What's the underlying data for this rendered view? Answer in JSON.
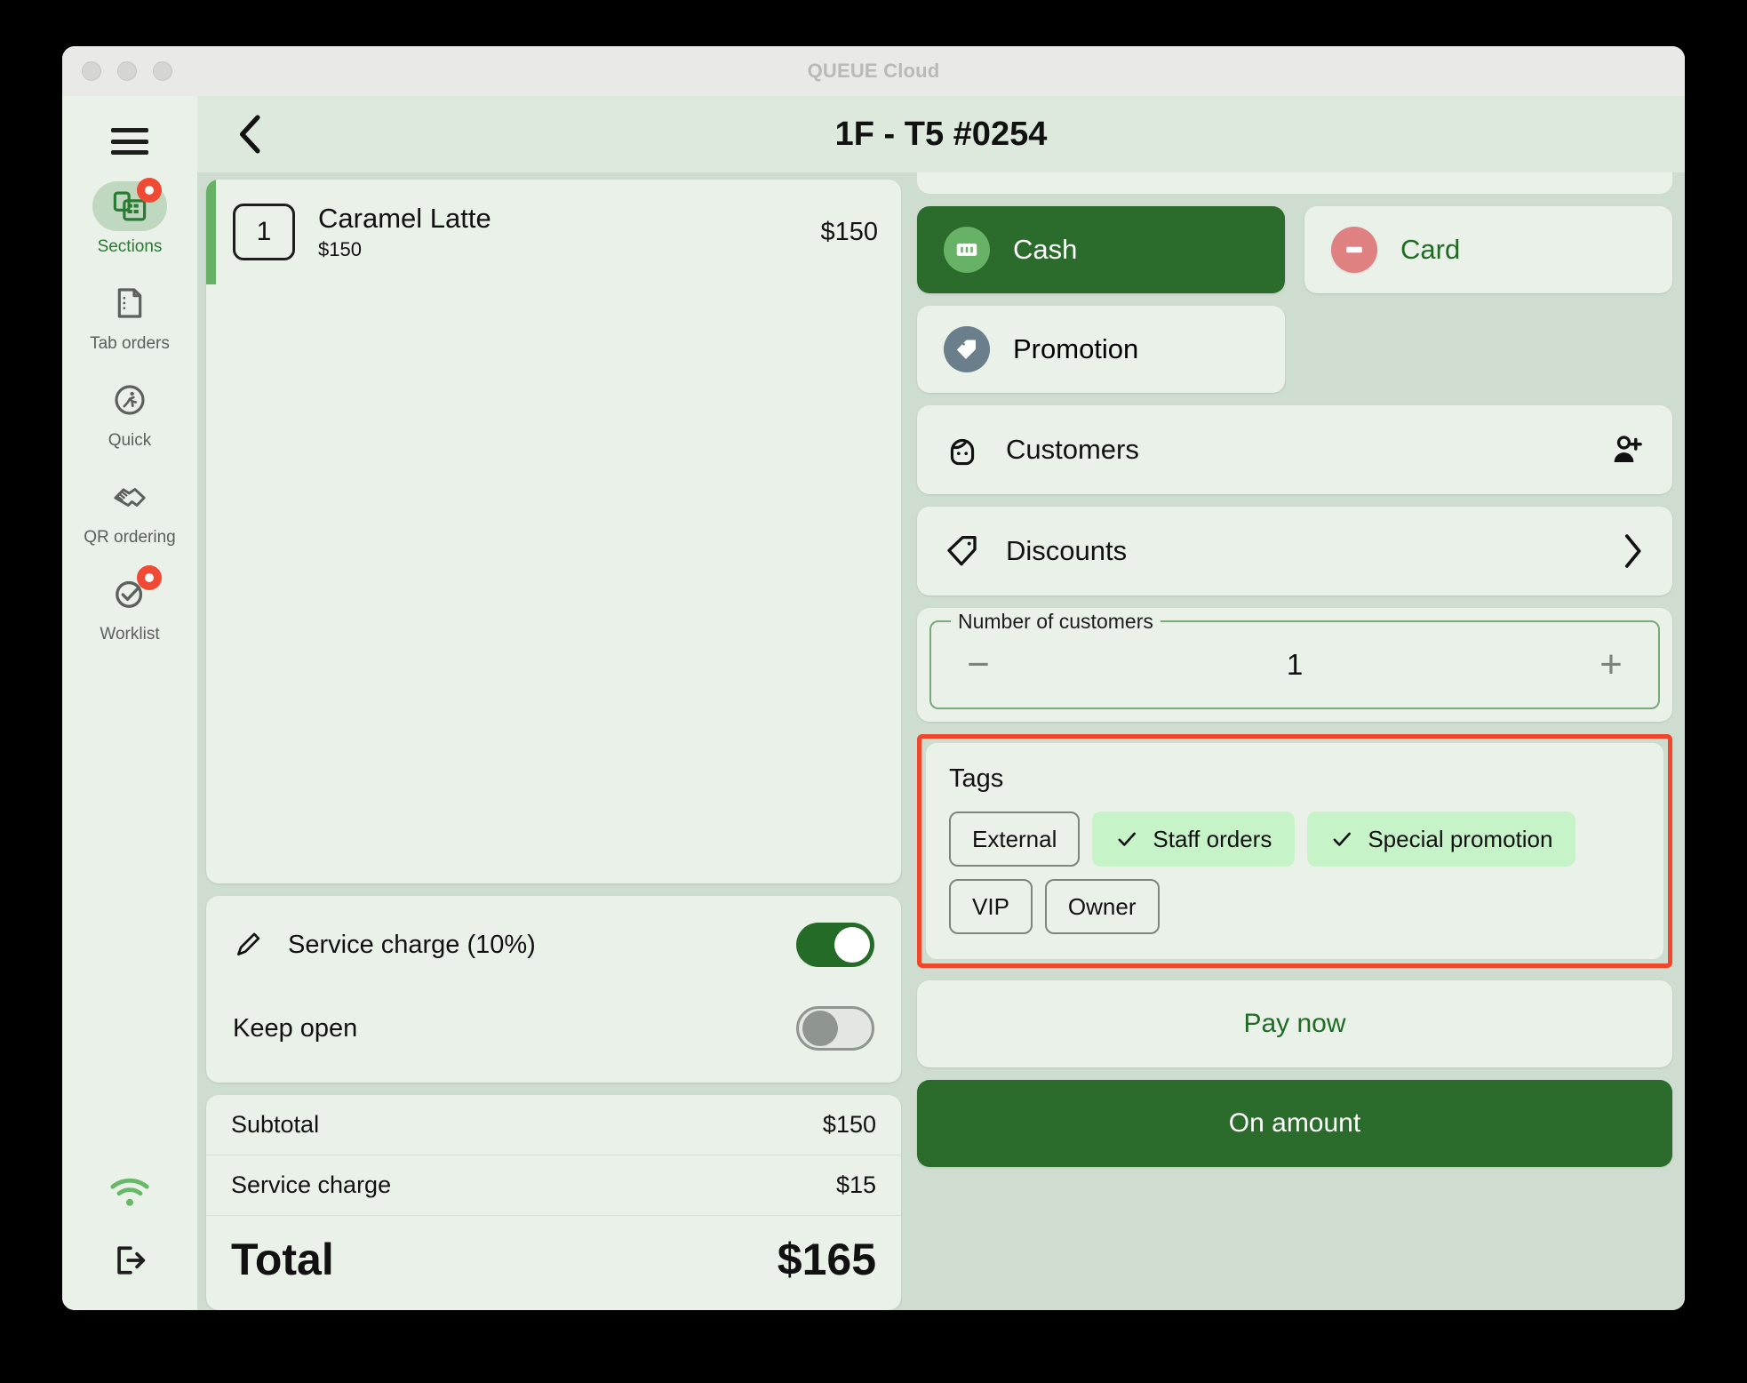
{
  "window": {
    "title": "QUEUE Cloud",
    "traffic_lights": [
      "close",
      "minimize",
      "maximize"
    ]
  },
  "sidebar": {
    "menu_icon": "hamburger-icon",
    "items": [
      {
        "label": "Sections",
        "icon": "sections-grid-icon",
        "active": true,
        "badge": true
      },
      {
        "label": "Tab orders",
        "icon": "document-icon",
        "active": false,
        "badge": false
      },
      {
        "label": "Quick",
        "icon": "running-person-icon",
        "active": false,
        "badge": false
      },
      {
        "label": "QR ordering",
        "icon": "handshake-icon",
        "active": false,
        "badge": false
      },
      {
        "label": "Worklist",
        "icon": "check-circle-icon",
        "active": false,
        "badge": true
      }
    ],
    "bottom_items": [
      {
        "icon": "wifi-icon",
        "name": "wifi-status"
      },
      {
        "icon": "logout-icon",
        "name": "logout-button"
      }
    ]
  },
  "topbar": {
    "back_icon": "chevron-left-icon",
    "order_title": "1F - T5 #0254"
  },
  "order": {
    "items": [
      {
        "qty": "1",
        "name": "Caramel Latte",
        "unit_price": "$150",
        "line_total": "$150"
      }
    ]
  },
  "charges": {
    "service_charge_label": "Service charge (10%)",
    "service_charge_on": true,
    "keep_open_label": "Keep open",
    "keep_open_on": false,
    "edit_icon": "pencil-icon"
  },
  "totals": {
    "rows": [
      {
        "label": "Subtotal",
        "value": "$150"
      },
      {
        "label": "Service charge",
        "value": "$15"
      }
    ],
    "grand_label": "Total",
    "grand_value": "$165"
  },
  "payment": {
    "cash_label": "Cash",
    "cash_icon": "banknote-icon",
    "cash_selected": true,
    "card_label": "Card",
    "card_icon": "credit-card-icon",
    "promotion_label": "Promotion",
    "promotion_icon": "price-tag-icon"
  },
  "rows": {
    "customers_label": "Customers",
    "customers_icon": "customer-face-icon",
    "customers_action_icon": "add-person-icon",
    "discounts_label": "Discounts",
    "discounts_icon": "discount-tag-icon",
    "discounts_action_icon": "chevron-right-icon"
  },
  "stepper": {
    "legend": "Number of customers",
    "value": "1",
    "minus": "−",
    "plus": "+"
  },
  "tags": {
    "title": "Tags",
    "highlight_color": "#f1462a",
    "items": [
      {
        "label": "External",
        "selected": false
      },
      {
        "label": "Staff orders",
        "selected": true
      },
      {
        "label": "Special promotion",
        "selected": true
      },
      {
        "label": "VIP",
        "selected": false
      },
      {
        "label": "Owner",
        "selected": false
      }
    ]
  },
  "actions": {
    "pay_now_label": "Pay now",
    "on_amount_label": "On amount"
  },
  "colors": {
    "brand_green": "#2b6b2b",
    "accent_green": "#66b166",
    "panel_bg": "#e9f1e9",
    "app_bg": "#cfdcd0",
    "badge_red": "#f04a34",
    "highlight_red": "#f1462a"
  }
}
